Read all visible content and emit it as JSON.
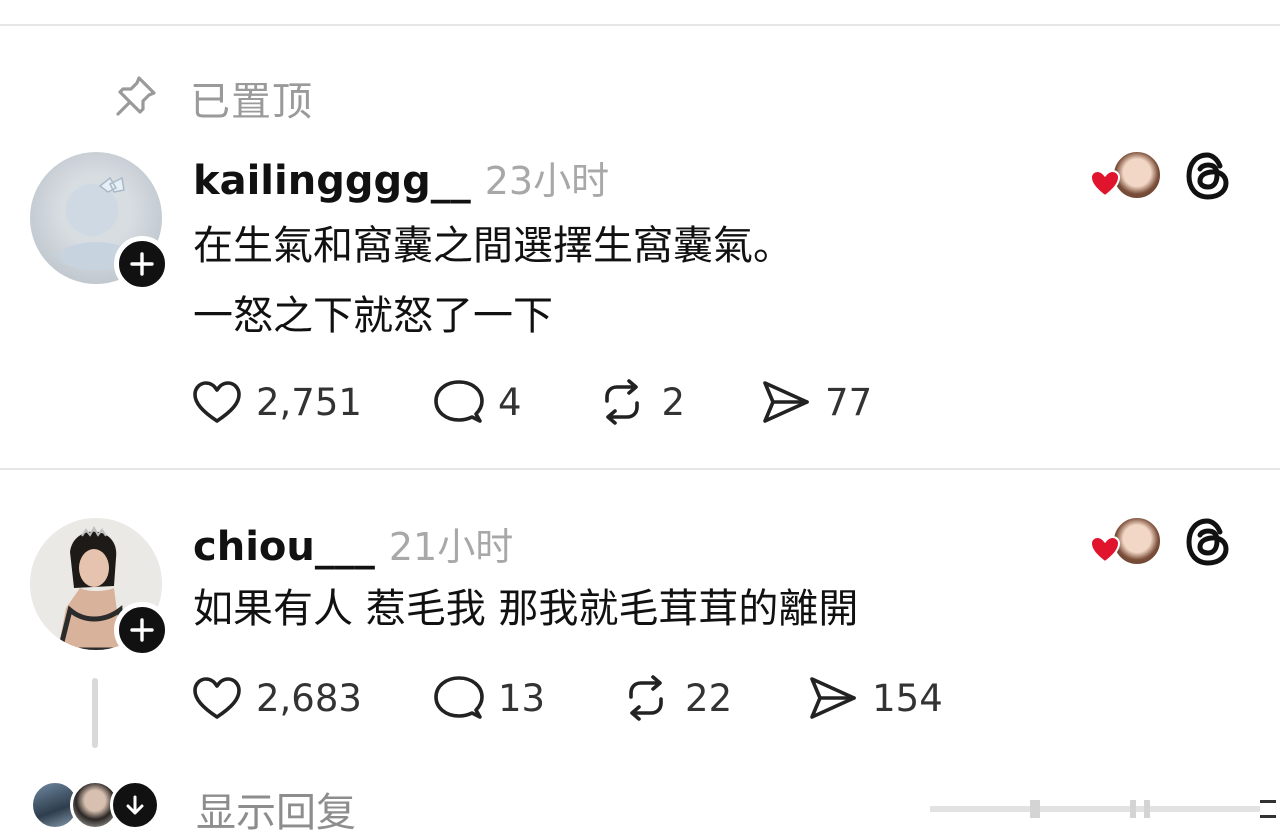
{
  "pinned": {
    "label": "已置顶",
    "icon": "pin-icon"
  },
  "posts": [
    {
      "username": "kailingggg__",
      "time": "23小时",
      "lines": [
        "在生氣和窩囊之間選擇生窩囊氣。",
        "一怒之下就怒了一下"
      ],
      "likes": "2,751",
      "comments": "4",
      "reposts": "2",
      "shares": "77"
    },
    {
      "username": "chiou___",
      "time": "21小时",
      "lines": [
        "如果有人 惹毛我 那我就毛茸茸的離開"
      ],
      "likes": "2,683",
      "comments": "13",
      "reposts": "22",
      "shares": "154"
    }
  ],
  "show_replies": {
    "label": "显示回复"
  },
  "colors": {
    "accent_heart": "#e0142c",
    "text_muted": "#a8a8a8"
  }
}
